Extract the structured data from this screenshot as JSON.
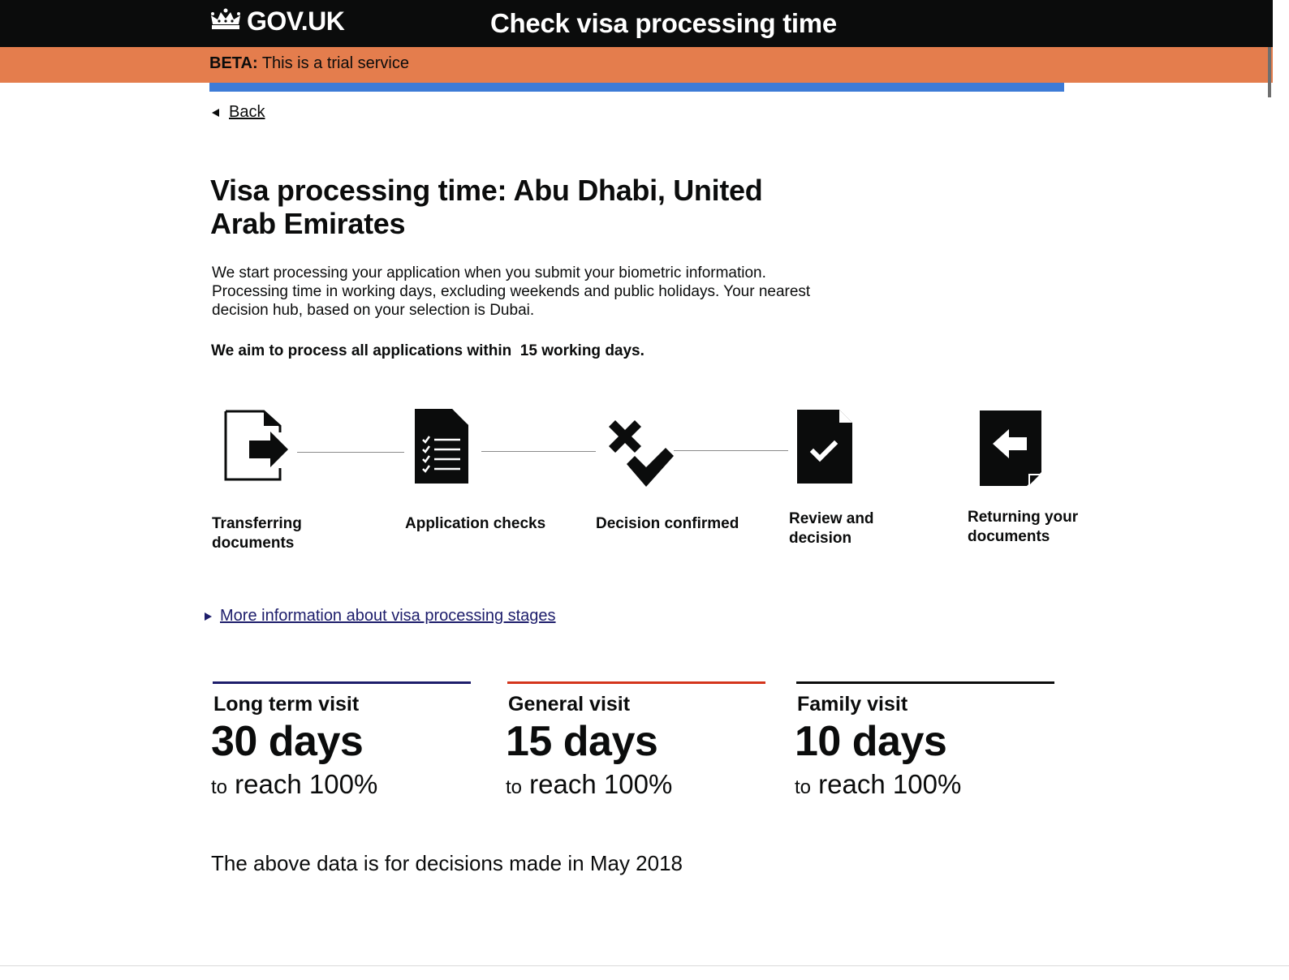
{
  "header": {
    "logo_text": "GOV.UK",
    "logo_icon": "crown-icon",
    "service_name": "Check visa processing time"
  },
  "beta_banner": {
    "tag": "BETA:",
    "text": " This is a trial service"
  },
  "back_link": {
    "label": "Back"
  },
  "page": {
    "title": "Visa processing time: Abu Dhabi, United Arab Emirates",
    "intro": "We start processing your application when you submit your biometric information. Processing time in working days, excluding weekends and public holidays. Your nearest decision hub, based on your selection is Dubai.",
    "aim": "We aim to process all applications within  15 working days."
  },
  "stages": [
    {
      "label": "Transferring documents",
      "icon": "document-transfer-icon"
    },
    {
      "label": "Application checks",
      "icon": "checklist-document-icon"
    },
    {
      "label": "Decision confirmed",
      "icon": "cross-and-tick-icon"
    },
    {
      "label": "Review and decision",
      "icon": "document-tick-icon"
    },
    {
      "label": "Returning your documents",
      "icon": "document-return-icon"
    }
  ],
  "more_info": {
    "label": "More information about visa processing stages"
  },
  "stats": [
    {
      "title": "Long term visit",
      "value": "30 days",
      "caption_small": "to",
      "caption": " reach 100%",
      "color": "#1d1d6b"
    },
    {
      "title": "General visit",
      "value": "15 days",
      "caption_small": "to",
      "caption": " reach 100%",
      "color": "#d4351c"
    },
    {
      "title": "Family visit",
      "value": "10 days",
      "caption_small": "to",
      "caption": " reach 100%",
      "color": "#0b0c0c"
    }
  ],
  "footnote": "The above data is for decisions made in May 2018",
  "colors": {
    "header_bg": "#0b0c0c",
    "beta_bg": "#e47d4d",
    "blue_bar": "#3d7bd6",
    "link": "#1d1d6b"
  }
}
